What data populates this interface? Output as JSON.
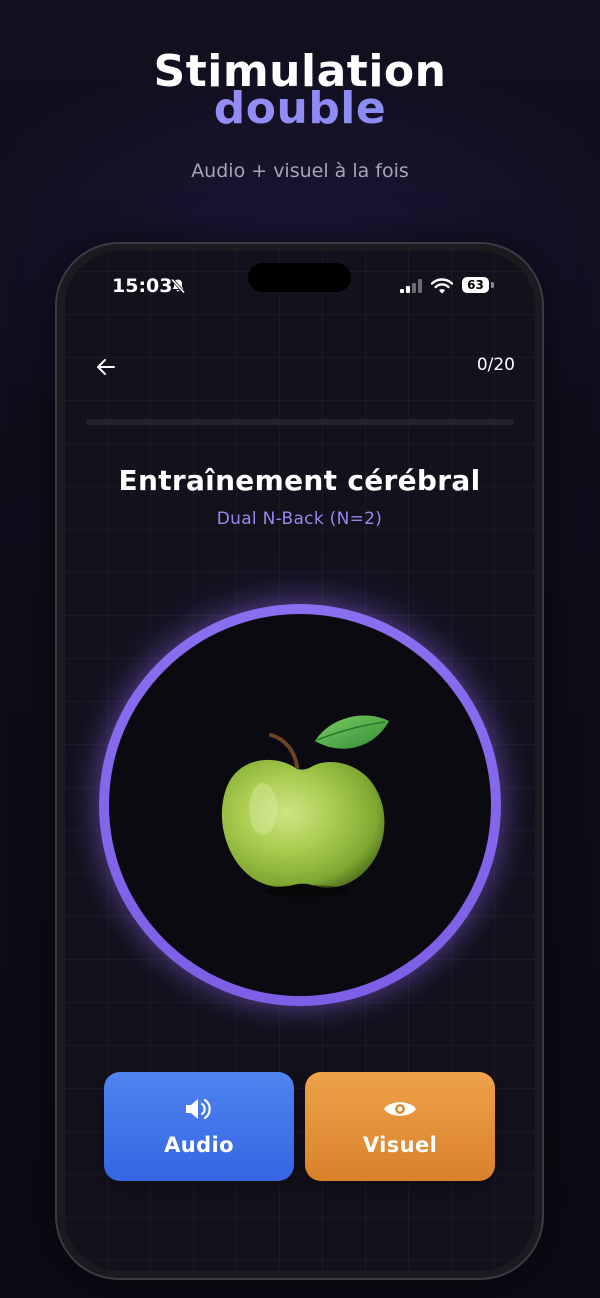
{
  "marketing": {
    "headline_line1": "Stimulation",
    "headline_line2": "double",
    "tagline": "Audio + visuel à la fois"
  },
  "status_bar": {
    "time": "15:03",
    "battery": "63",
    "icons": [
      "bell-slash-icon",
      "cellular-signal-icon",
      "wifi-icon",
      "battery-icon"
    ]
  },
  "header": {
    "back_icon": "arrow-left-icon",
    "progress_text": "0/20",
    "progress_fraction": 0
  },
  "main": {
    "title": "Entraînement cérébral",
    "subtitle": "Dual N-Back (N=2)",
    "stimulus": "green-apple-image"
  },
  "actions": {
    "audio_label": "Audio",
    "audio_icon": "speaker-icon",
    "visual_label": "Visuel",
    "visual_icon": "eye-icon"
  },
  "colors": {
    "accent": "#8b6cf0",
    "audio_button": "#4a7cee",
    "visual_button": "#e69640"
  }
}
